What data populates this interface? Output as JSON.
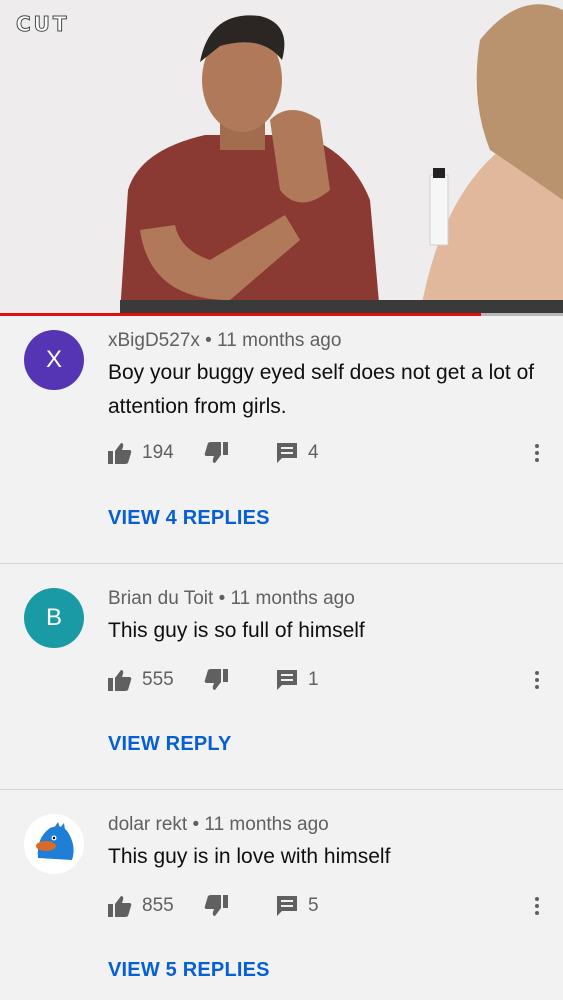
{
  "video": {
    "logo": "CUT",
    "progress_fraction": 0.855
  },
  "colors": {
    "accent_red": "#e20f0f",
    "link_blue": "#065fd4"
  },
  "comments": [
    {
      "avatar_letter": "X",
      "avatar_color": "#5535b3",
      "author": "xBigD527x",
      "time": "11 months ago",
      "text": "Boy your buggy eyed self does not get a lot of attention from girls.",
      "likes": "194",
      "reply_count": "4",
      "view_replies_label": "VIEW 4 REPLIES"
    },
    {
      "avatar_letter": "B",
      "avatar_color": "#1a9aa5",
      "author": "Brian du Toit",
      "time": "11 months ago",
      "text": "This guy is so full of himself",
      "likes": "555",
      "reply_count": "1",
      "view_replies_label": "VIEW REPLY"
    },
    {
      "avatar_icon": "blue-bird-icon",
      "author": "dolar rekt",
      "time": "11 months ago",
      "text": "This guy is in love with himself",
      "likes": "855",
      "reply_count": "5",
      "view_replies_label": "VIEW 5 REPLIES"
    }
  ]
}
